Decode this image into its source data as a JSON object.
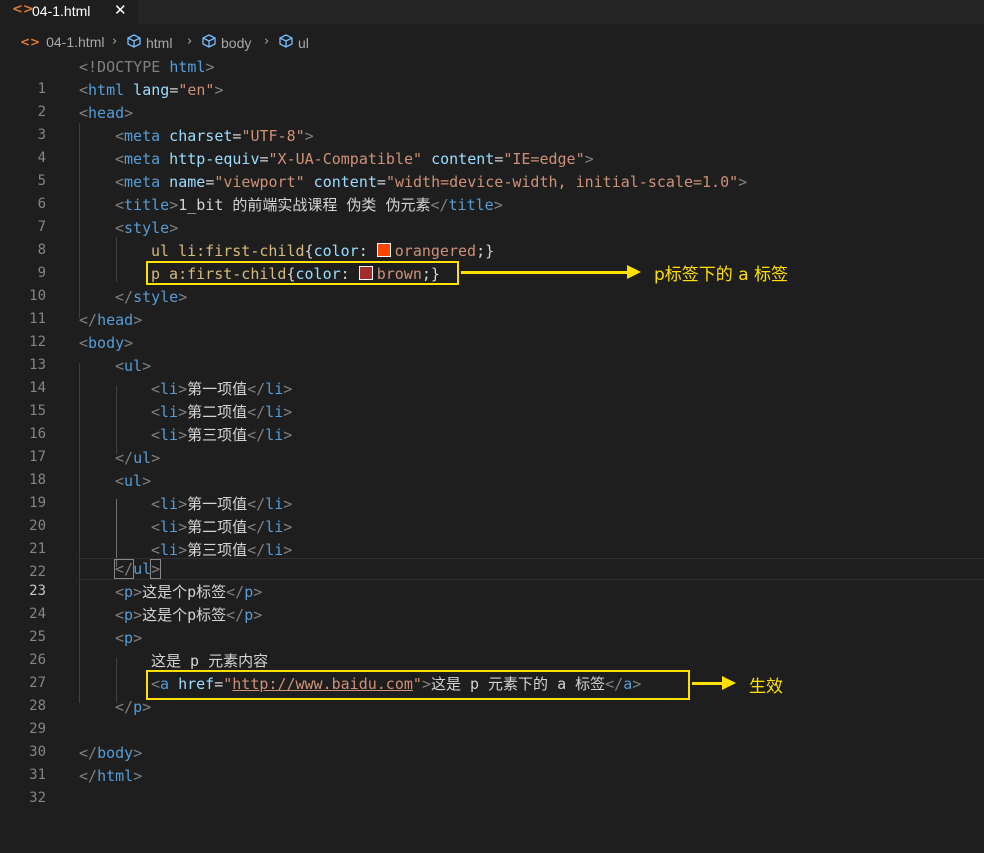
{
  "tab": {
    "label": "04-1.html",
    "icon": "html-file-icon",
    "close_glyph": "✕"
  },
  "breadcrumb": {
    "items": [
      "04-1.html",
      "html",
      "body",
      "ul"
    ],
    "separator": "›"
  },
  "editor": {
    "active_line": 23,
    "line_numbers": [
      "1",
      "2",
      "3",
      "4",
      "5",
      "6",
      "7",
      "8",
      "9",
      "10",
      "11",
      "12",
      "13",
      "14",
      "15",
      "16",
      "17",
      "18",
      "19",
      "20",
      "21",
      "22",
      "23",
      "24",
      "25",
      "26",
      "27",
      "28",
      "29",
      "30",
      "31",
      "32"
    ],
    "css_colors": {
      "orangered": "#ff4500",
      "brown": "#a52a2a"
    }
  },
  "code": {
    "l1": [
      "<!DOCTYPE ",
      "html",
      ">"
    ],
    "l2": [
      "<",
      "html",
      " lang",
      "=",
      "\"en\"",
      ">"
    ],
    "l3": [
      "<",
      "head",
      ">"
    ],
    "l4": [
      "<",
      "meta",
      " charset",
      "=",
      "\"UTF-8\"",
      ">"
    ],
    "l5": [
      "<",
      "meta",
      " http-equiv",
      "=",
      "\"X-UA-Compatible\"",
      " content",
      "=",
      "\"IE=edge\"",
      ">"
    ],
    "l6": [
      "<",
      "meta",
      " name",
      "=",
      "\"viewport\"",
      " content",
      "=",
      "\"width=device-width, initial-scale=1.0\"",
      ">"
    ],
    "l7": [
      "<",
      "title",
      ">",
      "1_bit 的前端实战课程 伪类 伪元素",
      "</",
      "title",
      ">"
    ],
    "l8": [
      "<",
      "style",
      ">"
    ],
    "l9": [
      "ul li:first-child",
      "{",
      "color",
      ": ",
      "orangered",
      ";}"
    ],
    "l10": [
      "p a:first-child",
      "{",
      "color",
      ": ",
      "brown",
      ";}"
    ],
    "l11": [
      "</",
      "style",
      ">"
    ],
    "l12": [
      "</",
      "head",
      ">"
    ],
    "l13": [
      "<",
      "body",
      ">"
    ],
    "l14": [
      "<",
      "ul",
      ">"
    ],
    "l15": [
      "<",
      "li",
      ">",
      "第一项值",
      "</",
      "li",
      ">"
    ],
    "l16": [
      "<",
      "li",
      ">",
      "第二项值",
      "</",
      "li",
      ">"
    ],
    "l17": [
      "<",
      "li",
      ">",
      "第三项值",
      "</",
      "li",
      ">"
    ],
    "l18": [
      "</",
      "ul",
      ">"
    ],
    "l19": [
      "<",
      "ul",
      ">"
    ],
    "l20": [
      "<",
      "li",
      ">",
      "第一项值",
      "</",
      "li",
      ">"
    ],
    "l21": [
      "<",
      "li",
      ">",
      "第二项值",
      "</",
      "li",
      ">"
    ],
    "l22": [
      "<",
      "li",
      ">",
      "第三项值",
      "</",
      "li",
      ">"
    ],
    "l23": [
      "</",
      "ul",
      ">"
    ],
    "l24": [
      "<",
      "p",
      ">",
      "这是个p标签",
      "</",
      "p",
      ">"
    ],
    "l25": [
      "<",
      "p",
      ">",
      "这是个p标签",
      "</",
      "p",
      ">"
    ],
    "l26": [
      "<",
      "p",
      ">"
    ],
    "l27": [
      "这是 p 元素内容"
    ],
    "l28": [
      "<",
      "a",
      " href",
      "=",
      "\"",
      "http://www.baidu.com",
      "\"",
      ">",
      "这是 p 元素下的 a 标签",
      "</",
      "a",
      ">"
    ],
    "l29": [
      "</",
      "p",
      ">"
    ],
    "l30": [],
    "l31": [
      "</",
      "body",
      ">"
    ],
    "l32": [
      "</",
      "html",
      ">"
    ]
  },
  "annotations": {
    "style_rule_note": "p标签下的 a 标签",
    "link_note": "生效",
    "highlight_color": "#ffe000"
  }
}
